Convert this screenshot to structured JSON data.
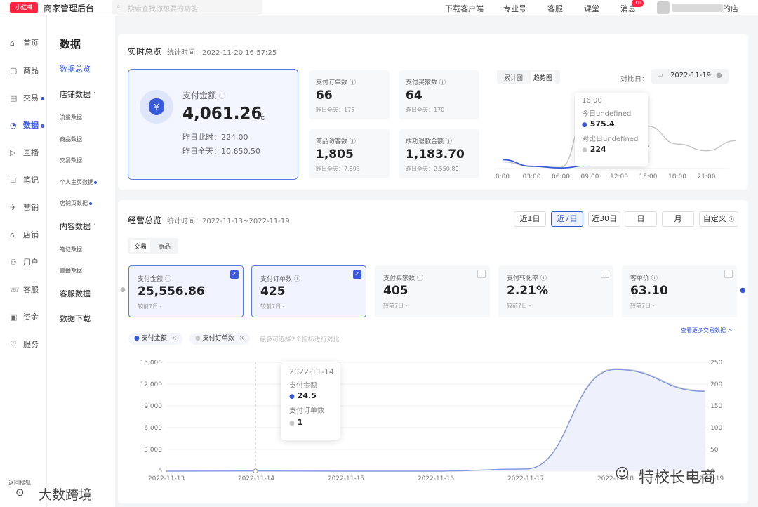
{
  "topbar": {
    "logo": "小红书",
    "brand": "商家管理后台",
    "search_placeholder": "搜索查找你想要的功能",
    "nav": [
      "下载客户端",
      "专业号",
      "客服",
      "课堂",
      "消息"
    ],
    "msg_badge": "10",
    "store_suffix": "的店"
  },
  "sidebar": {
    "items": [
      {
        "label": "首页",
        "icon": "home-icon",
        "glyph": "⌂"
      },
      {
        "label": "商品",
        "icon": "goods-icon",
        "glyph": "▢"
      },
      {
        "label": "交易",
        "icon": "trade-icon",
        "glyph": "▤"
      },
      {
        "label": "数据",
        "icon": "data-icon",
        "glyph": "◔"
      },
      {
        "label": "直播",
        "icon": "live-icon",
        "glyph": "▷"
      },
      {
        "label": "笔记",
        "icon": "note-icon",
        "glyph": "⊞"
      },
      {
        "label": "营销",
        "icon": "marketing-icon",
        "glyph": "✈"
      },
      {
        "label": "店铺",
        "icon": "store-icon",
        "glyph": "⌂"
      },
      {
        "label": "用户",
        "icon": "user-icon",
        "glyph": "⚇"
      },
      {
        "label": "客服",
        "icon": "service-icon",
        "glyph": "☏"
      },
      {
        "label": "资金",
        "icon": "fund-icon",
        "glyph": "▣"
      },
      {
        "label": "服务",
        "icon": "services-icon",
        "glyph": "♡"
      }
    ]
  },
  "subnav": {
    "title": "数据",
    "overview": "数据总览",
    "store_group": "店铺数据",
    "store_items": [
      "流量数据",
      "商品数据",
      "交易数据",
      "个人主页数据",
      "店铺页数据"
    ],
    "content_group": "内容数据",
    "content_items": [
      "笔记数据",
      "直播数据"
    ],
    "service": "客服数据",
    "download": "数据下载"
  },
  "realtime": {
    "title": "实时总览",
    "stat_time": "统计时间：2022-11-20 16:57:25",
    "main": {
      "label": "支付金额",
      "value": "4,061.26",
      "unit": "元",
      "yesterday_now": "昨日此时：224.00",
      "yesterday_all": "昨日全天：10,650.50"
    },
    "metrics": [
      {
        "label": "支付订单数",
        "value": "66",
        "sub": "昨日全天：175"
      },
      {
        "label": "支付买家数",
        "value": "64",
        "sub": "昨日全天：170"
      },
      {
        "label": "商品访客数",
        "value": "1,805",
        "sub": "昨日全天：7,893"
      },
      {
        "label": "成功退款金额",
        "value": "1,183.70",
        "sub": "昨日全天：2,550.80"
      }
    ],
    "seg": [
      "累计图",
      "趋势图"
    ],
    "compare_label": "对比日：",
    "compare_date": "2022-11-19",
    "tooltip": {
      "time": "16:00",
      "today_label": "今日undefined",
      "today_value": "575.4",
      "cmp_label": "对比日undefined",
      "cmp_value": "224"
    },
    "chart_data": {
      "type": "line",
      "x": [
        "0:00",
        "03:00",
        "06:00",
        "09:00",
        "12:00",
        "15:00",
        "18:00",
        "21:00"
      ],
      "series": [
        {
          "values": [
            60,
            20,
            10,
            600,
            150,
            380,
            220,
            160,
            250
          ]
        },
        {
          "values": [
            80,
            20,
            5,
            30,
            350,
            200,
            460,
            500
          ]
        }
      ]
    },
    "colors": {
      "today": "#3a5bd9",
      "compare": "#c8c8c8"
    }
  },
  "business": {
    "title": "经营总览",
    "stat_time": "统计时间：2022-11-13~2022-11-19",
    "ranges": [
      "近1日",
      "近7日",
      "近30日",
      "日",
      "月",
      "自定义"
    ],
    "tabs": [
      "交易",
      "商品"
    ],
    "kpis": [
      {
        "label": "支付金额",
        "value": "25,556.86",
        "sub": "较前7日",
        "selected": true
      },
      {
        "label": "支付订单数",
        "value": "425",
        "sub": "较前7日",
        "selected": true
      },
      {
        "label": "支付买家数",
        "value": "405",
        "sub": "较前7日",
        "selected": false
      },
      {
        "label": "支付转化率",
        "value": "2.21%",
        "sub": "较前7日",
        "selected": false
      },
      {
        "label": "客单价",
        "value": "63.10",
        "sub": "较前7日",
        "selected": false
      }
    ],
    "chips": [
      "支付金额",
      "支付订单数"
    ],
    "hint": "最多可选择2个指标进行对比",
    "more": "查看更多交易数据 >",
    "tooltip": {
      "date": "2022-11-14",
      "l1": "支付金额",
      "v1": "24.5",
      "l2": "支付订单数",
      "v2": "1"
    },
    "chart_data": {
      "type": "area",
      "x": [
        "2022-11-13",
        "2022-11-14",
        "2022-11-15",
        "2022-11-16",
        "2022-11-17",
        "2022-11-18",
        "2022-11-19"
      ],
      "y_left_ticks": [
        "15,000",
        "12,000",
        "9,000",
        "6,000",
        "3,000",
        "0"
      ],
      "y_right_ticks": [
        "250",
        "200",
        "150",
        "100",
        "50",
        "0"
      ],
      "ylim": [
        0,
        15000
      ],
      "y2lim": [
        0,
        250
      ],
      "series": [
        {
          "name": "支付金额",
          "values": [
            0,
            24.5,
            0,
            0,
            300,
            14000,
            11000
          ]
        },
        {
          "name": "支付订单数",
          "values": [
            0,
            1,
            0,
            0,
            5,
            235,
            185
          ]
        }
      ]
    }
  },
  "watermarks": [
    "大数跨境",
    "特校长电商",
    "返回搜狐"
  ]
}
